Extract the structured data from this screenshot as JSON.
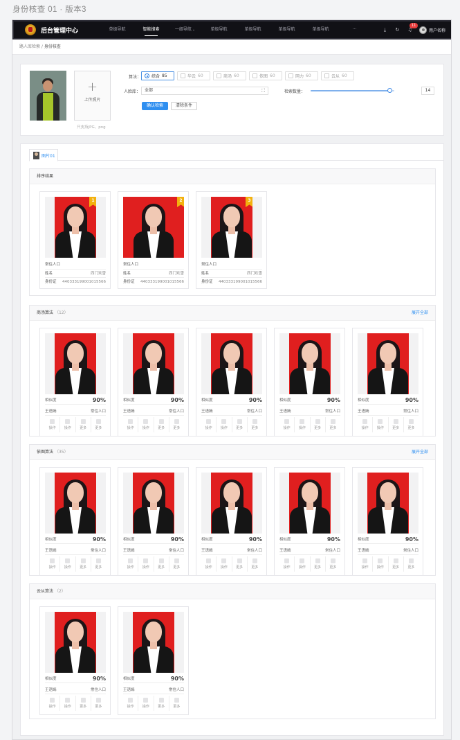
{
  "doc_title": "身份核查 01 · 版本3",
  "topbar": {
    "app_title": "后台管理中心",
    "nav": [
      {
        "label": "单级导航"
      },
      {
        "label": "智能搜索"
      },
      {
        "label": "一级导航",
        "caret": "⌄"
      },
      {
        "label": "单级导航"
      },
      {
        "label": "单级导航"
      },
      {
        "label": "单级导航"
      },
      {
        "label": "单级导航"
      },
      {
        "label": "···"
      }
    ],
    "active_index": 1,
    "download_icon": "⤓",
    "refresh_icon": "↻",
    "bell_icon": "♫",
    "badge": "11",
    "user_name": "用户名称"
  },
  "breadcrumb": {
    "parent": "路人库检索",
    "sep": " / ",
    "current": "身份核查"
  },
  "search": {
    "upload_label": "上传照片",
    "upload_hint": "只支持JPG、png",
    "algo_label": "算法：",
    "algorithms": [
      {
        "name": "综合",
        "score": "85",
        "selected": true
      },
      {
        "name": "华云",
        "score": "60"
      },
      {
        "name": "商汤",
        "score": "60"
      },
      {
        "name": "依图",
        "score": "60"
      },
      {
        "name": "网力",
        "score": "60"
      },
      {
        "name": "云从",
        "score": "60"
      }
    ],
    "facedb_label": "人脸库：",
    "facedb_value": "全部",
    "fullscreen_icon": "⛶",
    "count_label": "检索数量：",
    "count_value": "14",
    "slider_fraction": 0.95,
    "confirm_label": "确认检索",
    "clear_label": "清除条件"
  },
  "results": {
    "tab_label": "图片01",
    "sort_section": {
      "title": "排序结果",
      "cards": [
        {
          "rank": "1",
          "type": "常住人口",
          "name_key": "姓名",
          "name_val": "西门欢雪",
          "id_key": "身份证",
          "id_val": "440333199001015566"
        },
        {
          "rank": "2",
          "type": "常住人口",
          "name_key": "姓名",
          "name_val": "西门欢雪",
          "id_key": "身份证",
          "id_val": "440333199001015566"
        },
        {
          "rank": "3",
          "type": "常住人口",
          "name_key": "姓名",
          "name_val": "西门欢雪",
          "id_key": "身份证",
          "id_val": "440333199001015566"
        }
      ]
    },
    "algo_sections": [
      {
        "title": "商汤算法",
        "count": "12",
        "expand": "展开全部"
      },
      {
        "title": "依图算法",
        "count": "35",
        "expand": "展开全部"
      },
      {
        "title": "云从算法",
        "count": "2",
        "expand": ""
      }
    ],
    "card": {
      "sim_key": "相似度",
      "sim_val": "90%",
      "name": "王语嫣",
      "type": "常住人口",
      "ops": [
        "操作",
        "操作",
        "更多",
        "更多"
      ]
    }
  },
  "colors": {
    "accent": "#2f8ff0",
    "ribbon": "#f3b10e",
    "photo_bg": "#e01f1f",
    "topbar": "#111116"
  }
}
